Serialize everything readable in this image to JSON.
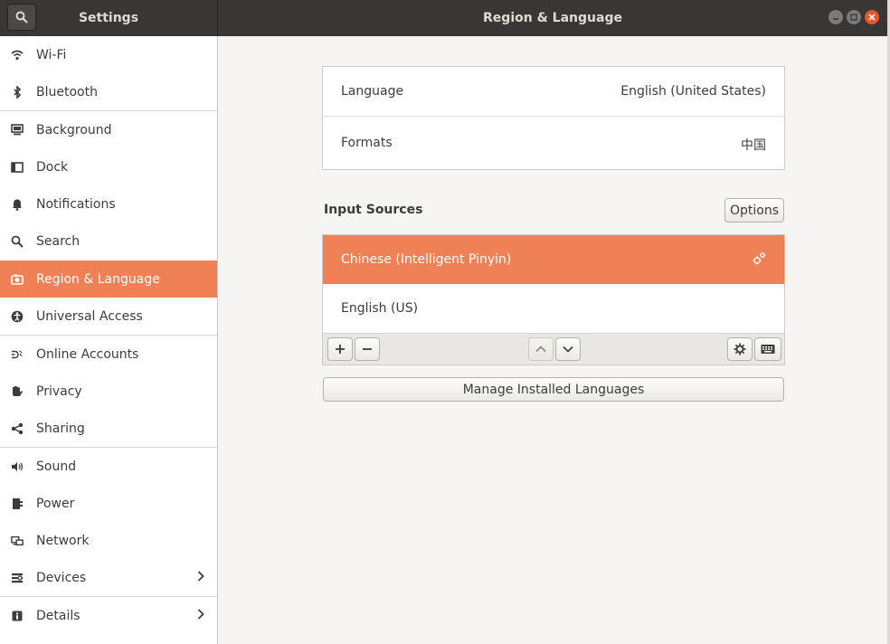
{
  "header": {
    "app_title": "Settings",
    "window_title": "Region & Language"
  },
  "sidebar": {
    "items": [
      {
        "label": "Wi-Fi",
        "icon": "wifi-icon"
      },
      {
        "label": "Bluetooth",
        "icon": "bluetooth-icon"
      },
      {
        "label": "Background",
        "icon": "background-icon"
      },
      {
        "label": "Dock",
        "icon": "dock-icon"
      },
      {
        "label": "Notifications",
        "icon": "bell-icon"
      },
      {
        "label": "Search",
        "icon": "search-icon"
      },
      {
        "label": "Region & Language",
        "icon": "region-icon",
        "active": true
      },
      {
        "label": "Universal Access",
        "icon": "accessibility-icon"
      },
      {
        "label": "Online Accounts",
        "icon": "online-accounts-icon"
      },
      {
        "label": "Privacy",
        "icon": "hand-icon"
      },
      {
        "label": "Sharing",
        "icon": "share-icon"
      },
      {
        "label": "Sound",
        "icon": "speaker-icon"
      },
      {
        "label": "Power",
        "icon": "power-icon"
      },
      {
        "label": "Network",
        "icon": "network-icon"
      },
      {
        "label": "Devices",
        "icon": "devices-icon",
        "has_chevron": true
      },
      {
        "label": "Details",
        "icon": "info-icon",
        "has_chevron": true
      }
    ]
  },
  "region": {
    "language_label": "Language",
    "language_value": "English (United States)",
    "formats_label": "Formats",
    "formats_value": "中国"
  },
  "input_sources": {
    "heading": "Input Sources",
    "options_label": "Options",
    "sources": [
      {
        "label": "Chinese (Intelligent Pinyin)",
        "selected": true
      },
      {
        "label": "English (US)",
        "selected": false
      }
    ],
    "manage_label": "Manage Installed Languages"
  },
  "colors": {
    "accent": "#f08157",
    "titlebar": "#383735",
    "close_button": "#e6582c"
  }
}
